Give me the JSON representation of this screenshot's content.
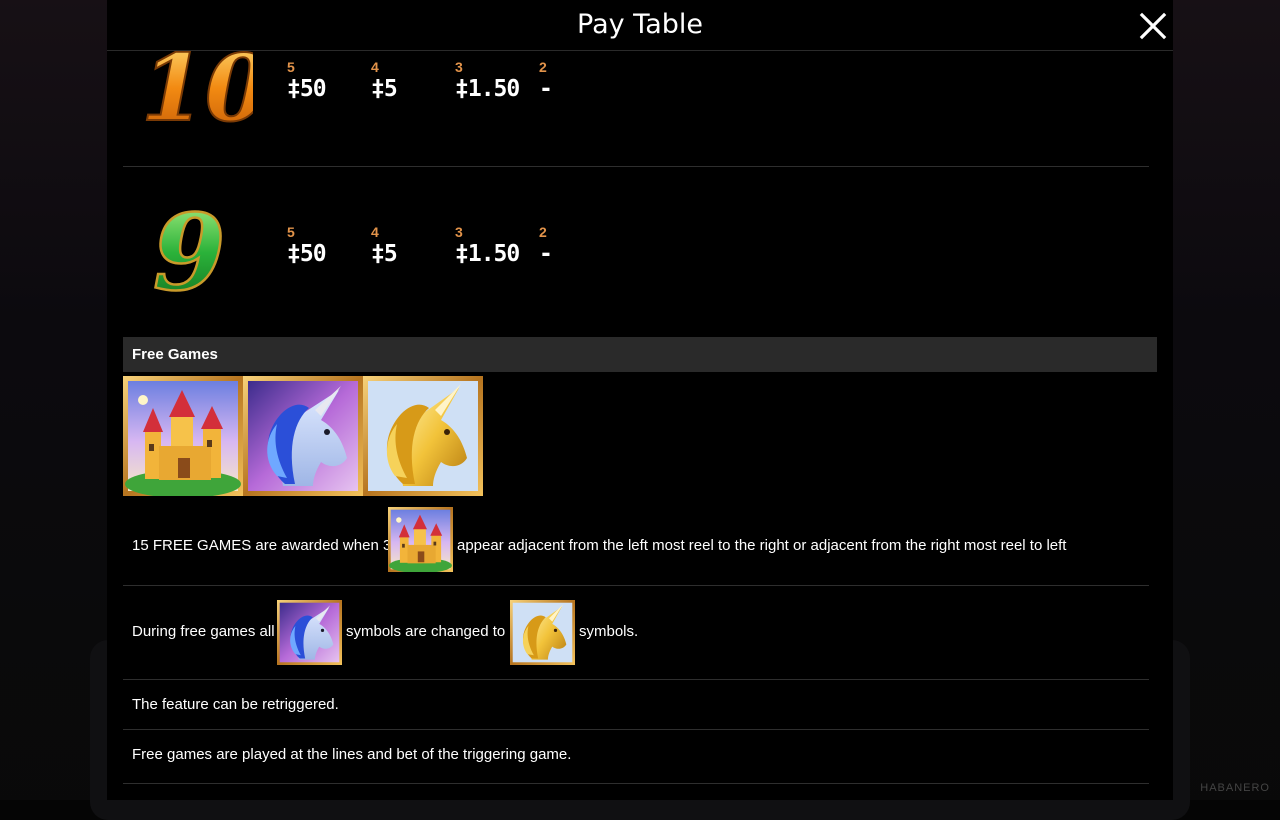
{
  "dialog": {
    "title": "Pay Table"
  },
  "pay_rows": [
    {
      "symbol": "10",
      "pays": [
        {
          "count": "5",
          "value": "‡50"
        },
        {
          "count": "4",
          "value": "‡5"
        },
        {
          "count": "3",
          "value": "‡1.50"
        },
        {
          "count": "2",
          "value": "-"
        }
      ]
    },
    {
      "symbol": "9",
      "pays": [
        {
          "count": "5",
          "value": "‡50"
        },
        {
          "count": "4",
          "value": "‡5"
        },
        {
          "count": "3",
          "value": "‡1.50"
        },
        {
          "count": "2",
          "value": "-"
        }
      ]
    }
  ],
  "free_games": {
    "heading": "Free Games",
    "rule1_before": "15 FREE GAMES are awarded when 3",
    "rule1_after": "appear adjacent from the left most reel to the right or adjacent from the right most reel to left",
    "rule2_before": "During free games all",
    "rule2_mid": "symbols are changed to",
    "rule2_after": "symbols.",
    "rule3": "The feature can be retriggered.",
    "rule4": "Free games are played at the lines and bet of the triggering game."
  },
  "symbols": [
    "castle-icon",
    "white-unicorn-icon",
    "gold-unicorn-icon"
  ],
  "colors": {
    "count_label": "#e2934a",
    "section_header_bg": "#2a2a2a",
    "background": "#000000"
  },
  "watermark": "HABANERO"
}
